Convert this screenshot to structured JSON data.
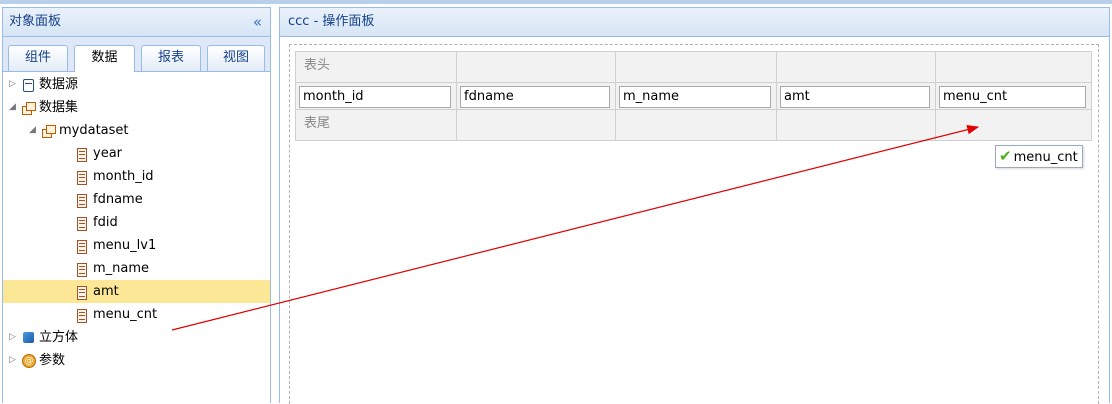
{
  "left_panel": {
    "title": "对象面板",
    "collapse_icon": "«",
    "tabs": [
      {
        "label": "组件"
      },
      {
        "label": "数据"
      },
      {
        "label": "报表"
      },
      {
        "label": "视图"
      }
    ],
    "tree": {
      "datasource": "数据源",
      "dataset": "数据集",
      "mydataset": "mydataset",
      "fields": [
        "year",
        "month_id",
        "fdname",
        "fdid",
        "menu_lv1",
        "m_name",
        "amt",
        "menu_cnt"
      ],
      "cube": "立方体",
      "params": "参数"
    }
  },
  "right_panel": {
    "title": "ccc - 操作面板",
    "header_label": "表头",
    "footer_label": "表尾",
    "columns": [
      "month_id",
      "fdname",
      "m_name",
      "amt",
      "menu_cnt"
    ],
    "drag_tooltip": "menu_cnt"
  },
  "colors": {
    "selected_row": "#fbe796",
    "arrow": "#e00000",
    "panel_border": "#99bbe8"
  }
}
